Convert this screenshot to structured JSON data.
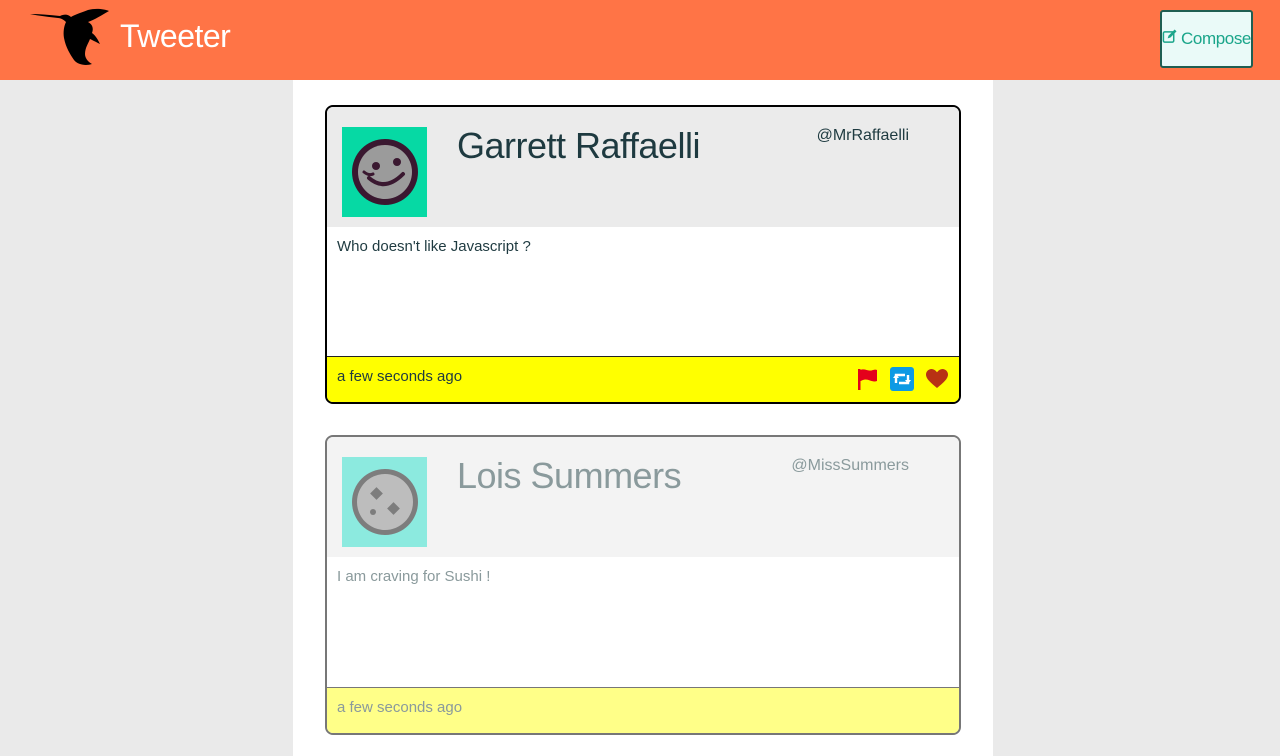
{
  "app": {
    "title": "Tweeter",
    "colors": {
      "nav": "#ff7446",
      "accent": "#1aa58a",
      "footer_yellow": "#ffff00"
    }
  },
  "nav": {
    "logo_icon": "hummingbird-icon",
    "compose_label": "Compose",
    "compose_icon": "edit-icon"
  },
  "tweets": [
    {
      "name": "Garrett Raffaelli",
      "handle": "@MrRaffaelli",
      "text": "Who doesn't like Javascript ?",
      "timestamp": "a few seconds ago",
      "avatar_icon": "smiley-avatar-icon",
      "actions": [
        "flag-icon",
        "retweet-icon",
        "heart-icon"
      ]
    },
    {
      "name": "Lois Summers",
      "handle": "@MissSummers",
      "text": "I am craving for Sushi !",
      "timestamp": "a few seconds ago",
      "avatar_icon": "dice-avatar-icon"
    }
  ]
}
